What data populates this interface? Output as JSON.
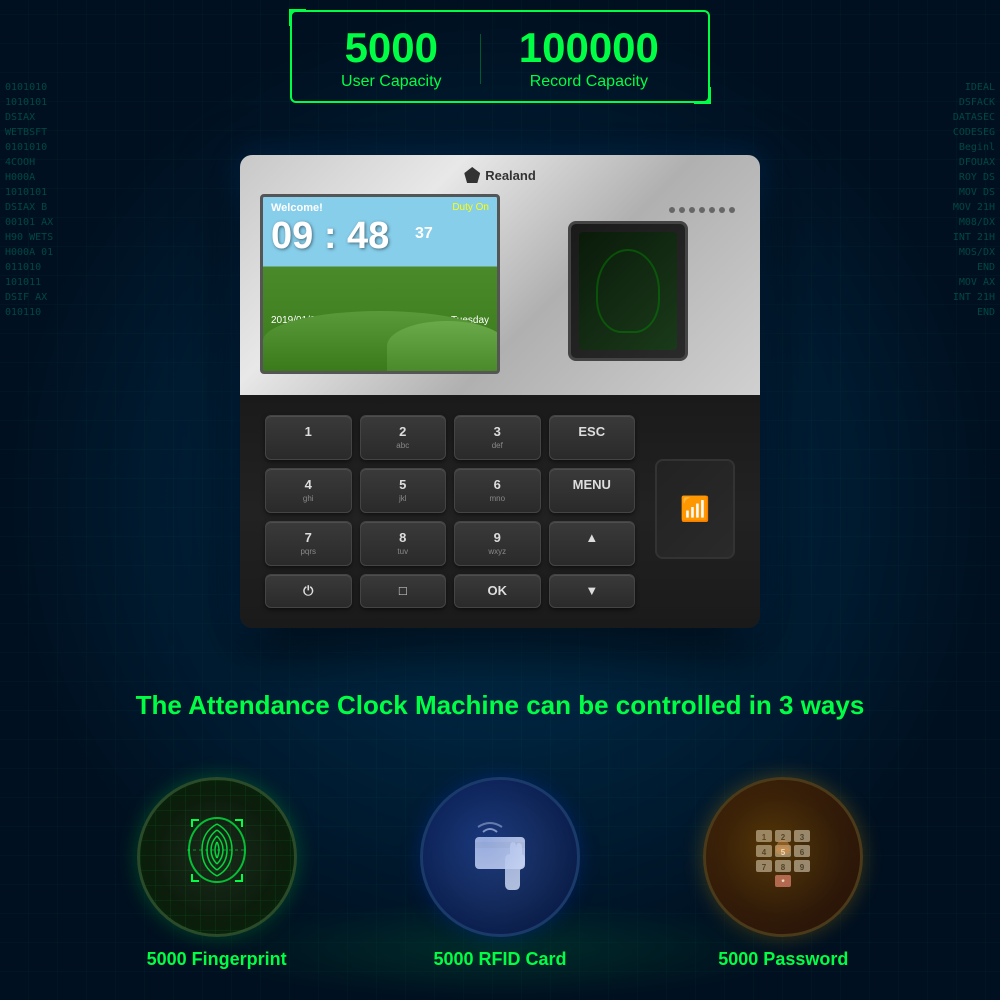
{
  "background": {
    "color": "#001a2e"
  },
  "capacity": {
    "user_number": "5000",
    "user_label": "User  Capacity",
    "record_number": "100000",
    "record_label": "Record Capacity"
  },
  "device": {
    "brand": "Realand",
    "screen": {
      "welcome": "Welcome!",
      "time": "09 : 48",
      "seconds": "37",
      "duty": "Duty On",
      "date": "2019/01/01",
      "day": "Tuesday"
    },
    "keypad": [
      {
        "main": "1",
        "sub": ""
      },
      {
        "main": "2",
        "sub": "abc"
      },
      {
        "main": "3",
        "sub": "def"
      },
      {
        "main": "ESC",
        "sub": ""
      },
      {
        "main": "4",
        "sub": "ghi"
      },
      {
        "main": "5",
        "sub": "jkl"
      },
      {
        "main": "6",
        "sub": "mno"
      },
      {
        "main": "MENU",
        "sub": ""
      },
      {
        "main": "7",
        "sub": "pqrs"
      },
      {
        "main": "8",
        "sub": "tuv"
      },
      {
        "main": "9",
        "sub": "wxyz"
      },
      {
        "main": "▲",
        "sub": ""
      },
      {
        "main": "⏻",
        "sub": ""
      },
      {
        "main": "□",
        "sub": ""
      },
      {
        "main": "OK",
        "sub": ""
      },
      {
        "main": "▼",
        "sub": ""
      }
    ]
  },
  "tagline": "The Attendance Clock Machine can be controlled in 3 ways",
  "features": [
    {
      "type": "fingerprint",
      "label": "5000 Fingerprint",
      "circle_class": "feature-circle-fp"
    },
    {
      "type": "rfid",
      "label": "5000 RFID Card",
      "circle_class": "feature-circle-rfid"
    },
    {
      "type": "password",
      "label": "5000 Password",
      "circle_class": "feature-circle-pw"
    }
  ],
  "code_left": "0101010\n1010101\nDSIAX\nWETBSFT\n0101010\n4COOH\nH000A\n1010101\nDSIAX B\n00101 AX\nH90 WETS\nH000A 01",
  "code_right": "IDEAL\nDSFACK\nDATASEC\nCODESEG\nBeginl\nDFOUAX\nROY DS\nMOV DS\nMOV 21H\nM08/DX\nINT 21H\nMOS/DX\nEND"
}
